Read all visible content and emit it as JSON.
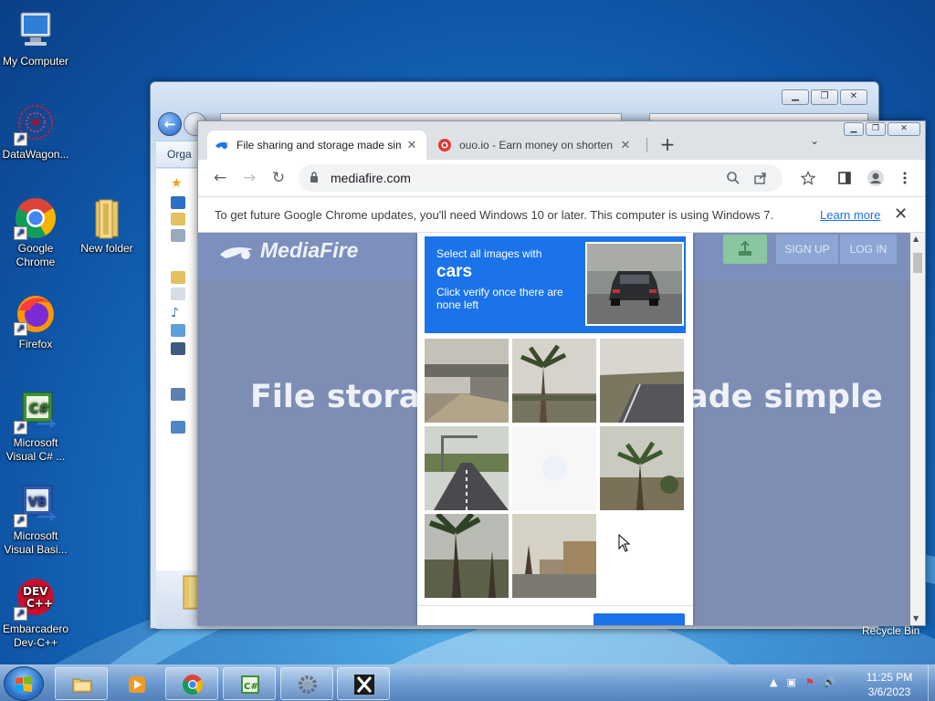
{
  "desktop": {
    "icons": [
      {
        "label": "My Computer"
      },
      {
        "label": "DataWagon..."
      },
      {
        "label": "Google Chrome"
      },
      {
        "label": "New folder"
      },
      {
        "label": "Firefox"
      },
      {
        "label": "Microsoft Visual C# ..."
      },
      {
        "label": "Microsoft Visual Basi..."
      },
      {
        "label": "Embarcadero Dev-C++"
      }
    ],
    "recycle_bin_label": "Recycle Bin"
  },
  "explorer": {
    "organize_label": "Orga"
  },
  "chrome": {
    "tabs": [
      {
        "title": "File sharing and storage made simple",
        "favicon": "mediafire-icon",
        "active": true
      },
      {
        "title": "ouo.io - Earn money on shorten links",
        "favicon": "ouo-icon",
        "active": false
      }
    ],
    "new_tab_label": "+",
    "url": "mediafire.com",
    "infobar": {
      "message": "To get future Google Chrome updates, you'll need Windows 10 or later. This computer is using Windows 7.",
      "link": "Learn more"
    },
    "colors": {
      "accent": "#1a73e8",
      "mediafire_bg": "#7e8db4"
    }
  },
  "mediafire": {
    "logo": "MediaFire",
    "signup": "SIGN UP",
    "login": "LOG IN",
    "hero_left": "File storag",
    "hero_right": "ade simple"
  },
  "captcha": {
    "prompt_line1": "Select all images with",
    "target": "cars",
    "prompt_line3": "Click verify once there are none left"
  },
  "taskbar": {
    "clock_time": "11:25 PM",
    "clock_date": "3/6/2023"
  }
}
